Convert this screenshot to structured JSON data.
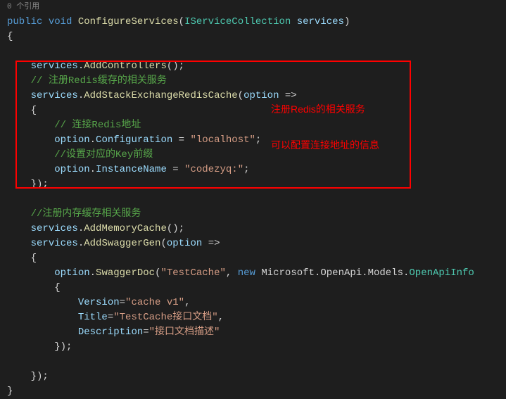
{
  "dimLine": "0  个引用",
  "line1": {
    "public": "public",
    "void": "void",
    "method": "ConfigureServices",
    "type": "IServiceCollection",
    "param": "services"
  },
  "line3": {
    "obj": "services",
    "method": "AddControllers"
  },
  "line4_comment": "// 注册Redis缓存的相关服务",
  "line5": {
    "obj": "services",
    "method": "AddStackExchangeRedisCache",
    "param": "option"
  },
  "line7_comment": "// 连接Redis地址",
  "line8": {
    "obj": "option",
    "prop": "Configuration",
    "val": "\"localhost\""
  },
  "line9_comment": "//设置对应的Key前缀",
  "line10": {
    "obj": "option",
    "prop": "InstanceName",
    "val": "\"codezyq:\""
  },
  "line12_comment": "//注册内存缓存相关服务",
  "line13": {
    "obj": "services",
    "method": "AddMemoryCache"
  },
  "line14": {
    "obj": "services",
    "method": "AddSwaggerGen",
    "param": "option"
  },
  "line16": {
    "obj": "option",
    "method": "SwaggerDoc",
    "arg1": "\"TestCache\"",
    "new": "new",
    "ns1": "Microsoft",
    "ns2": "OpenApi",
    "ns3": "Models",
    "cls": "OpenApiInfo"
  },
  "line18": {
    "prop": "Version",
    "val": "\"cache v1\""
  },
  "line19": {
    "prop": "Title",
    "val": "\"TestCache接口文档\""
  },
  "line20": {
    "prop": "Description",
    "val": "\"接口文档描述\""
  },
  "annotation1": "注册Redis的相关服务",
  "annotation2": "可以配置连接地址的信息"
}
